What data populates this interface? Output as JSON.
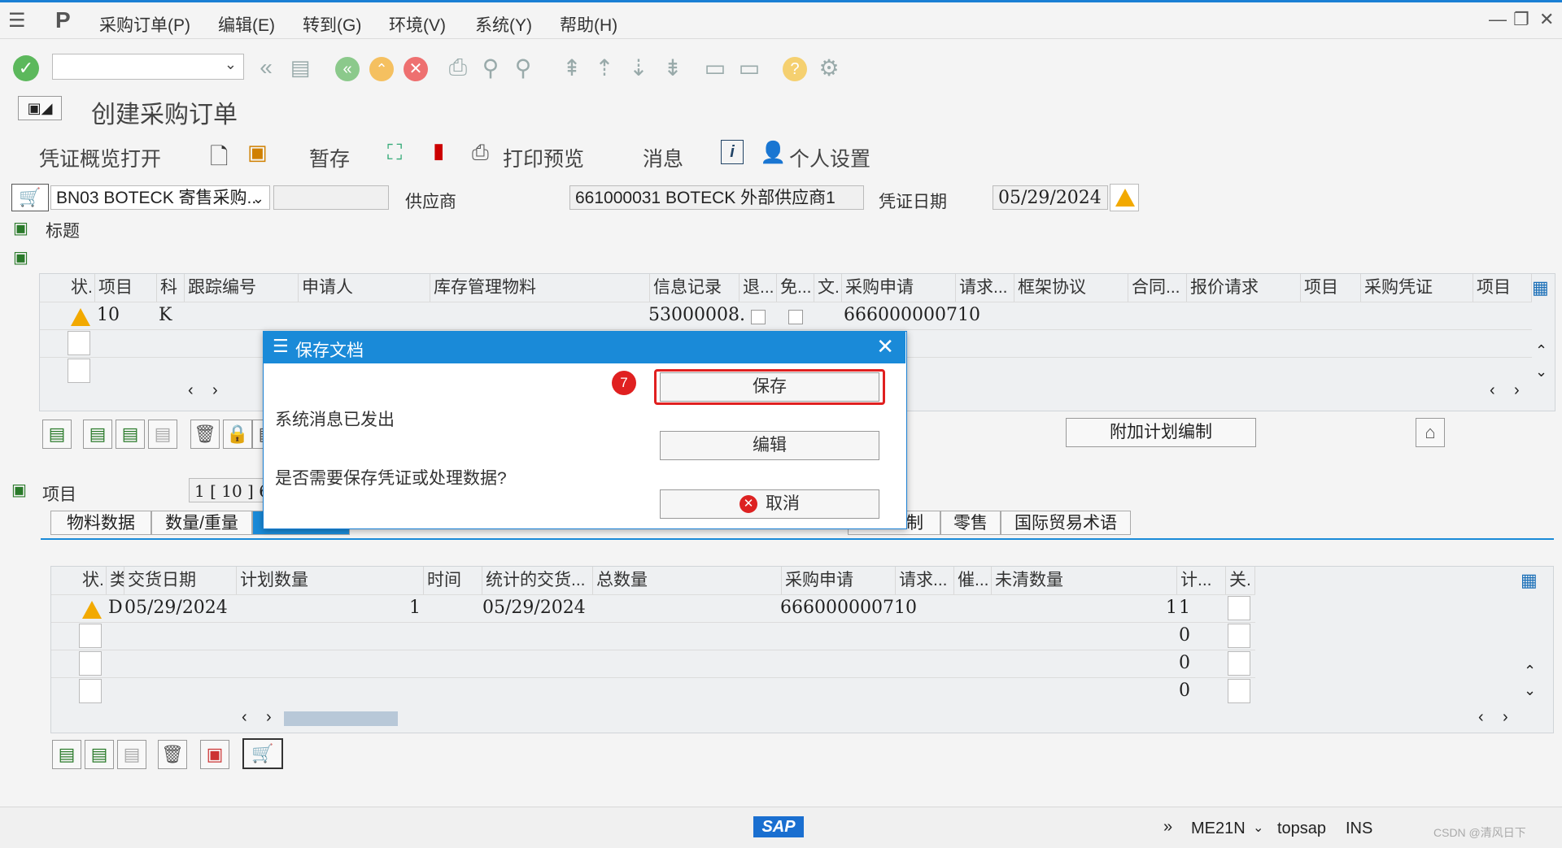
{
  "menu": {
    "items": [
      "采购订单(P)",
      "编辑(E)",
      "转到(G)",
      "环境(V)",
      "系统(Y)",
      "帮助(H)"
    ]
  },
  "window_controls": {
    "minimize": "—",
    "restore": "❐",
    "close": "✕"
  },
  "title": "创建采购订单",
  "app_toolbar": {
    "overview": "凭证概览打开",
    "hold": "暂存",
    "print_preview": "打印预览",
    "messages": "消息",
    "personal_settings": "个人设置"
  },
  "header": {
    "order_type": "BN03 BOTECK 寄售采购..",
    "vendor_label": "供应商",
    "vendor_value": "661000031 BOTECK 外部供应商1",
    "doc_date_label": "凭证日期",
    "doc_date_value": "05/29/2024",
    "header_label": "标题"
  },
  "item_grid": {
    "columns": [
      "状.",
      "项目",
      "科",
      "跟踪编号",
      "申请人",
      "库存管理物料",
      "信息记录",
      "退...",
      "免...",
      "文.",
      "采购申请",
      "请求...",
      "框架协议",
      "合同...",
      "报价请求",
      "项目",
      "采购凭证",
      "项目"
    ],
    "row1": {
      "item": "10",
      "acct": "K",
      "info_record": "53000008.",
      "pr": "6660000007",
      "req_item": "10"
    }
  },
  "add_plan_button": "附加计划编制",
  "item_section": {
    "label": "项目",
    "selector": "1 [ 10 ] 6"
  },
  "tabs": [
    "物料数据",
    "数量/重量",
    "制",
    "零售",
    "国际贸易术语"
  ],
  "schedule_grid": {
    "columns": [
      "状.",
      "类",
      "交货日期",
      "计划数量",
      "时间",
      "统计的交货...",
      "总数量",
      "采购申请",
      "请求...",
      "催...",
      "未清数量",
      "计...",
      "关."
    ],
    "row1": {
      "cat": "D",
      "date": "05/29/2024",
      "qty": "1",
      "stat_date": "05/29/2024",
      "pr": "6660000007",
      "req_item": "10",
      "open_qty": "1",
      "count": "1"
    },
    "zeros": [
      "0",
      "0",
      "0"
    ]
  },
  "dialog": {
    "title": "保存文档",
    "message1": "系统消息已发出",
    "message2": "是否需要保存凭证或处理数据?",
    "save": "保存",
    "edit": "编辑",
    "cancel": "取消",
    "step_badge": "7"
  },
  "status": {
    "transaction": "ME21N",
    "system": "topsap",
    "mode": "INS",
    "watermark": "CSDN @清风日下"
  },
  "colors": {
    "accent": "#1a8ad8",
    "warning": "#f2a900",
    "highlight": "#e02020"
  }
}
